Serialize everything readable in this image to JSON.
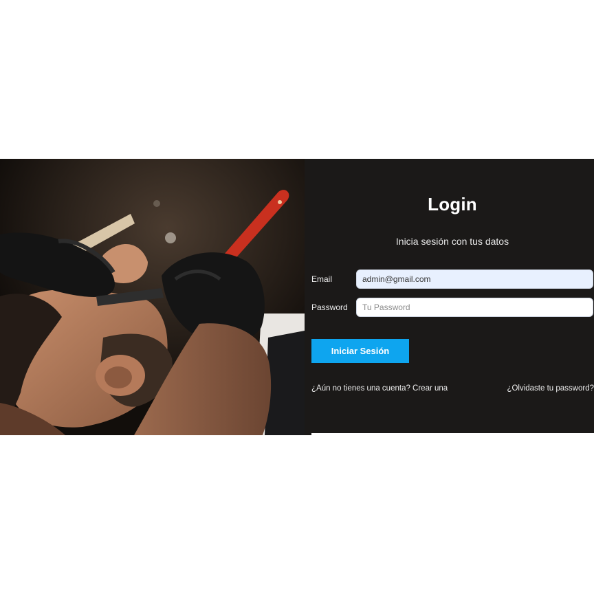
{
  "login": {
    "title": "Login",
    "subtitle": "Inicia sesión con tus datos",
    "email_label": "Email",
    "email_value": "admin@gmail.com",
    "password_label": "Password",
    "password_placeholder": "Tu Password",
    "submit_label": "Iniciar Sesión",
    "register_link": "¿Aún no tienes una cuenta? Crear una",
    "forgot_link": "¿Olvidaste tu password?"
  },
  "colors": {
    "panel_background": "#1b1918",
    "accent": "#0ea5ef",
    "email_field_background": "#e8f0fe"
  }
}
